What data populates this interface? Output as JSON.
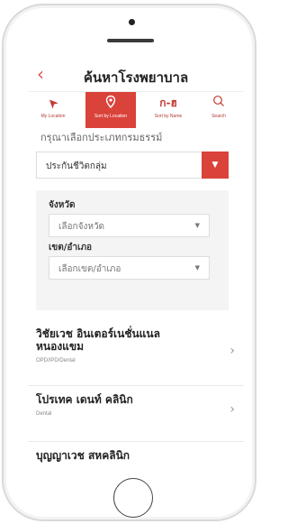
{
  "header": {
    "back_icon": "chevron-left-icon",
    "title": "ค้นหาโรงพยาบาล",
    "accent": "#d9433a"
  },
  "tabs": [
    {
      "label": "My Location",
      "icon": "navigation-arrow-icon",
      "glyph": "➤",
      "active": false
    },
    {
      "label": "Sort by Location",
      "icon": "location-pin-icon",
      "glyph": "⌖",
      "active": true
    },
    {
      "label": "Sort by Name",
      "icon": "alphabet-icon",
      "glyph": "ก-ฮ",
      "active": false
    },
    {
      "label": "Search",
      "icon": "search-icon",
      "glyph": "⌕",
      "active": false
    }
  ],
  "hint": "กรุณาเลือกประเภทกรมธรรม์",
  "policy_select": {
    "value": "ประกันชีวิตกลุ่ม",
    "arrow": "chevron-down-icon"
  },
  "filters": {
    "province_label": "จังหวัด",
    "province_placeholder": "เลือกจังหวัด",
    "district_label": "เขต/อำเภอ",
    "district_placeholder": "เลือกเขต/อำเภอ"
  },
  "hospitals": [
    {
      "name": "วิชัยเวช อินเตอร์เนชั่นแนล หนองแขม",
      "type": "OPD/IPD/Dental"
    },
    {
      "name": "โปรเทค เดนท์ คลินิก",
      "type": "Dental"
    },
    {
      "name": "บุญญาเวช สหคลินิก",
      "type": ""
    }
  ]
}
